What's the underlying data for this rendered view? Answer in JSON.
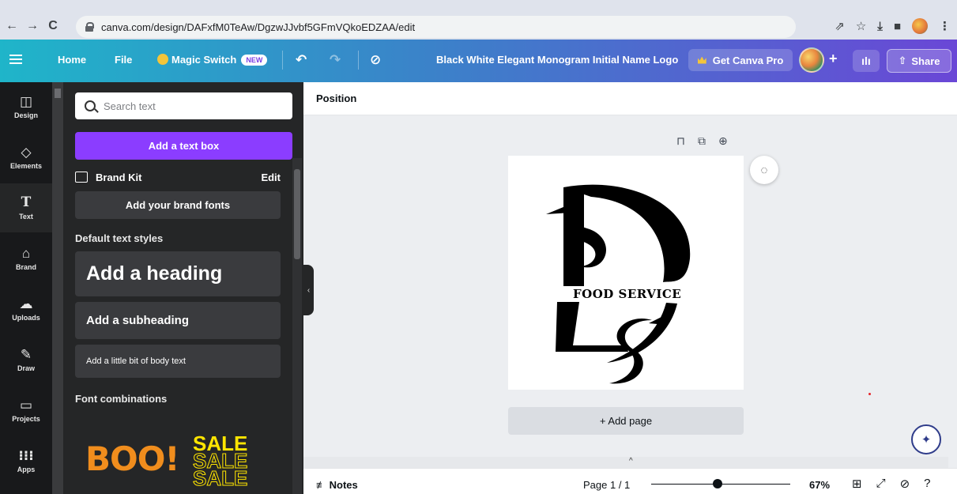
{
  "browser": {
    "url": "canva.com/design/DAFxfM0TeAw/DgzwJJvbf5GFmVQkoEDZAA/edit",
    "icons": [
      "back-arrow-icon",
      "forward-arrow-icon",
      "reload-icon",
      "lock-icon",
      "share-page-icon",
      "bookmark-star-icon",
      "download-icon",
      "sidepanel-icon",
      "profile-avatar",
      "more-vertical-icon"
    ]
  },
  "topbar": {
    "home": "Home",
    "file": "File",
    "magic_switch": "Magic Switch",
    "magic_badge": "NEW",
    "doc_title": "Black White Elegant Monogram Initial Name Logo",
    "get_pro": "Get Canva Pro",
    "share": "Share",
    "gradient_start": "#1fb5c9",
    "gradient_end": "#6a47d6"
  },
  "rail": {
    "items": [
      {
        "label": "Design",
        "icon": "layout-icon"
      },
      {
        "label": "Elements",
        "icon": "shapes-icon"
      },
      {
        "label": "Text",
        "icon": "text-t-icon",
        "active": true
      },
      {
        "label": "Brand",
        "icon": "brand-icon"
      },
      {
        "label": "Uploads",
        "icon": "cloud-upload-icon"
      },
      {
        "label": "Draw",
        "icon": "pen-icon"
      },
      {
        "label": "Projects",
        "icon": "folder-icon"
      },
      {
        "label": "Apps",
        "icon": "grid-dots-icon"
      }
    ]
  },
  "panel": {
    "search_placeholder": "Search text",
    "add_text_box": "Add a text box",
    "brand_kit": "Brand Kit",
    "brand_kit_edit": "Edit",
    "add_brand_fonts": "Add your brand fonts",
    "default_styles_label": "Default text styles",
    "heading": "Add a heading",
    "subheading": "Add a subheading",
    "body": "Add a little bit of body text",
    "font_combos_label": "Font combinations",
    "combo_boo": "BOO!",
    "combo_sale": "SALE",
    "accent": "#8b3dff"
  },
  "editor": {
    "position": "Position",
    "logo_text": "FOOD SERVICE",
    "add_page": "+ Add page",
    "notes": "Notes",
    "page": "Page 1 / 1",
    "zoom": "67%",
    "zoom_fraction": 0.67
  }
}
